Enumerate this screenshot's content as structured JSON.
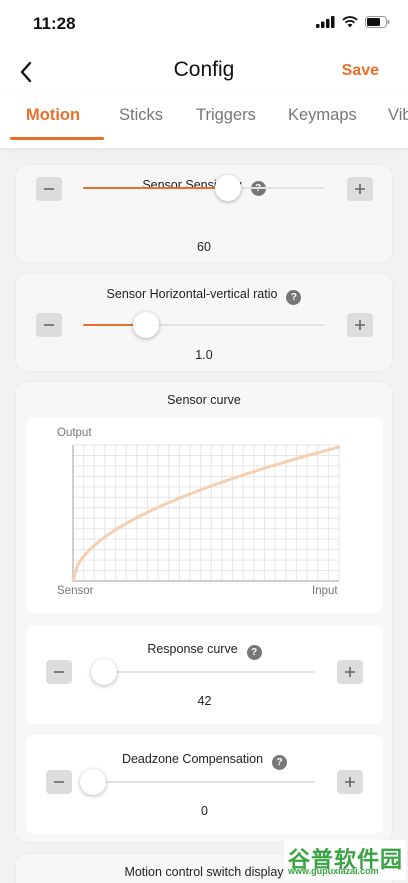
{
  "status_bar": {
    "time": "11:28"
  },
  "header": {
    "title": "Config",
    "save_label": "Save"
  },
  "tabs": [
    {
      "label": "Motion",
      "active": true
    },
    {
      "label": "Sticks",
      "active": false
    },
    {
      "label": "Triggers",
      "active": false
    },
    {
      "label": "Keymaps",
      "active": false
    },
    {
      "label": "Vib",
      "active": false
    }
  ],
  "sensor_sensitivity": {
    "label": "Sensor Sensitivity",
    "value": "60",
    "slider_fraction": 0.6
  },
  "sensor_ratio": {
    "label": "Sensor Horizontal-vertical ratio",
    "value": "1.0",
    "slider_fraction": 0.26
  },
  "sensor_curve": {
    "title": "Sensor curve",
    "y_label": "Output",
    "x_origin_label": "Sensor",
    "x_label": "Input",
    "curve_color": "#f5cfb2",
    "response_curve": {
      "label": "Response curve",
      "value": "42",
      "slider_fraction": 0.05
    },
    "deadzone": {
      "label": "Deadzone Compensation",
      "value": "0",
      "slider_fraction": 0.0
    }
  },
  "partial_section": {
    "label": "Motion control switch display"
  },
  "watermark": {
    "main": "谷普软件园",
    "sub": "www.gupuxiazai.com"
  },
  "colors": {
    "accent": "#e8702a",
    "background": "#f2f2f2",
    "card": "#f7f7f7"
  }
}
